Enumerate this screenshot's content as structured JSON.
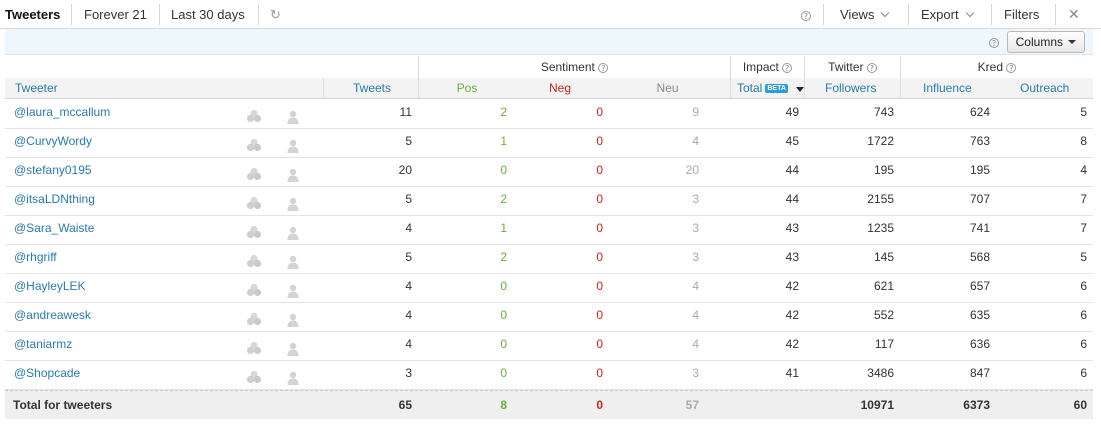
{
  "toolbar": {
    "tab_tweeters": "Tweeters",
    "filter_brand": "Forever 21",
    "filter_range": "Last 30 days",
    "views_label": "Views",
    "export_label": "Export",
    "filters_label": "Filters",
    "close_glyph": "✕",
    "refresh_glyph": "↻",
    "help_glyph": "?"
  },
  "columns_button": "Columns",
  "groups": {
    "sentiment": "Sentiment",
    "impact": "Impact",
    "twitter": "Twitter",
    "kred": "Kred"
  },
  "headers": {
    "tweeter": "Tweeter",
    "tweets": "Tweets",
    "pos": "Pos",
    "neg": "Neg",
    "neu": "Neu",
    "total": "Total",
    "beta": "BETA",
    "followers": "Followers",
    "influence": "Influence",
    "outreach": "Outreach"
  },
  "rows": [
    {
      "handle": "@laura_mccallum",
      "tweets": "11",
      "pos": "2",
      "neg": "0",
      "neu": "9",
      "total": "49",
      "followers": "743",
      "influence": "624",
      "outreach": "5"
    },
    {
      "handle": "@CurvyWordy",
      "tweets": "5",
      "pos": "1",
      "neg": "0",
      "neu": "4",
      "total": "45",
      "followers": "1722",
      "influence": "763",
      "outreach": "8"
    },
    {
      "handle": "@stefany0195",
      "tweets": "20",
      "pos": "0",
      "neg": "0",
      "neu": "20",
      "total": "44",
      "followers": "195",
      "influence": "195",
      "outreach": "4"
    },
    {
      "handle": "@itsaLDNthing",
      "tweets": "5",
      "pos": "2",
      "neg": "0",
      "neu": "3",
      "total": "44",
      "followers": "2155",
      "influence": "707",
      "outreach": "7"
    },
    {
      "handle": "@Sara_Waiste",
      "tweets": "4",
      "pos": "1",
      "neg": "0",
      "neu": "3",
      "total": "43",
      "followers": "1235",
      "influence": "741",
      "outreach": "7"
    },
    {
      "handle": "@rhgriff",
      "tweets": "5",
      "pos": "2",
      "neg": "0",
      "neu": "3",
      "total": "43",
      "followers": "145",
      "influence": "568",
      "outreach": "5"
    },
    {
      "handle": "@HayleyLEK",
      "tweets": "4",
      "pos": "0",
      "neg": "0",
      "neu": "4",
      "total": "42",
      "followers": "621",
      "influence": "657",
      "outreach": "6"
    },
    {
      "handle": "@andreawesk",
      "tweets": "4",
      "pos": "0",
      "neg": "0",
      "neu": "4",
      "total": "42",
      "followers": "552",
      "influence": "635",
      "outreach": "6"
    },
    {
      "handle": "@taniarmz",
      "tweets": "4",
      "pos": "0",
      "neg": "0",
      "neu": "4",
      "total": "42",
      "followers": "117",
      "influence": "636",
      "outreach": "6"
    },
    {
      "handle": "@Shopcade",
      "tweets": "3",
      "pos": "0",
      "neg": "0",
      "neu": "3",
      "total": "41",
      "followers": "3486",
      "influence": "847",
      "outreach": "6"
    }
  ],
  "totals": {
    "label": "Total for tweeters",
    "tweets": "65",
    "pos": "8",
    "neg": "0",
    "neu": "57",
    "followers": "10971",
    "influence": "6373",
    "outreach": "60"
  }
}
